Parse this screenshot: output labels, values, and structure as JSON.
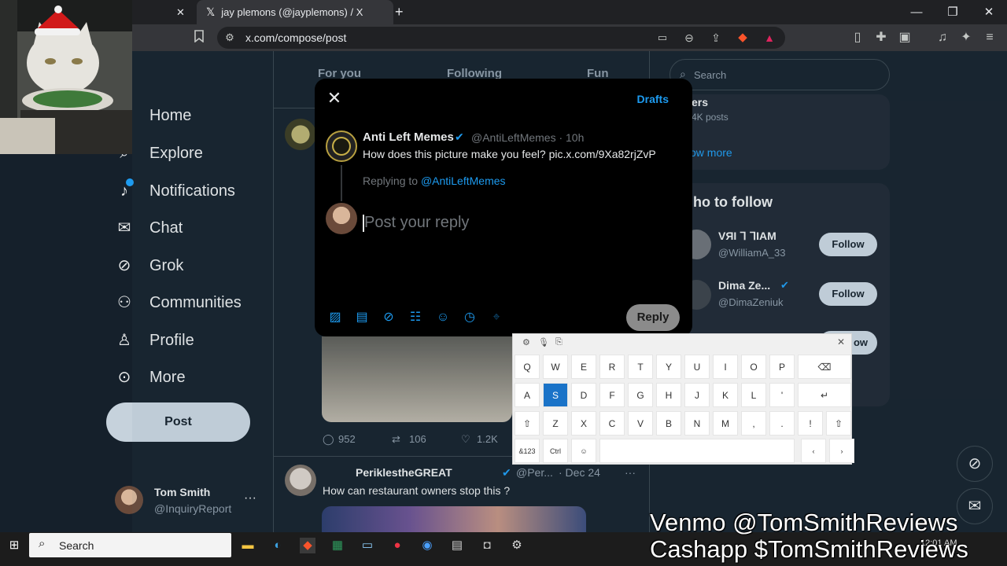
{
  "browser": {
    "tab_close_glyph": "✕",
    "tab_title": "jay plemons (@jayplemons) / X",
    "tab_logo": "𝕏",
    "new_tab_glyph": "+",
    "url": "x.com/compose/post"
  },
  "sidebar": {
    "items": [
      {
        "label": "Home",
        "icon": "home-icon"
      },
      {
        "label": "Explore",
        "icon": "search-icon"
      },
      {
        "label": "Notifications",
        "icon": "bell-icon"
      },
      {
        "label": "Chat",
        "icon": "mail-icon"
      },
      {
        "label": "Grok",
        "icon": "grok-icon"
      },
      {
        "label": "Communities",
        "icon": "communities-icon"
      },
      {
        "label": "Profile",
        "icon": "person-icon"
      },
      {
        "label": "More",
        "icon": "more-circle-icon"
      }
    ],
    "post_button": "Post",
    "account": {
      "name": "Tom Smith",
      "handle": "@InquiryReport",
      "more": "···"
    }
  },
  "feed": {
    "tabs": [
      "For you",
      "Following",
      "Fun"
    ],
    "tweet1_stats": {
      "replies": "952",
      "reposts": "106",
      "likes": "1.2K"
    },
    "tweet2": {
      "name": "PeriklestheGREAT",
      "handle": "@Per...",
      "date": "· Dec 24",
      "text": "How can restaurant owners stop this ?",
      "more": "···"
    }
  },
  "right": {
    "search_placeholder": "Search",
    "trend_partial": "ers",
    "trend_posts_partial": "4K posts",
    "show_more_partial": "ow more",
    "who_to_follow_partial": "ho to follow",
    "follow": [
      {
        "name": "VЯI ᒣ ᒣIAM",
        "handle": "@WilliamA_33",
        "button": "Follow"
      },
      {
        "name": "Dima Ze...",
        "handle": "@DimaZeniuk",
        "button": "Follow"
      }
    ],
    "third_follow_partial": "ow"
  },
  "modal": {
    "close": "✕",
    "drafts": "Drafts",
    "original": {
      "name": "Anti Left Memes",
      "handle": "@AntiLeftMemes · 10h",
      "text": "How does this picture make you feel? pic.x.com/9Xa82rjZvP"
    },
    "replying_prefix": "Replying to",
    "replying_handle": "@AntiLeftMemes",
    "reply_placeholder": "Post your reply",
    "reply_button": "Reply"
  },
  "keyboard": {
    "row1": [
      "Q",
      "W",
      "E",
      "R",
      "T",
      "Y",
      "U",
      "I",
      "O",
      "P",
      "⌫"
    ],
    "row2": [
      "A",
      "S",
      "D",
      "F",
      "G",
      "H",
      "J",
      "K",
      "L",
      "'",
      "↵"
    ],
    "row3": [
      "⇧",
      "Z",
      "X",
      "C",
      "V",
      "B",
      "N",
      "M",
      ",",
      ".",
      "!",
      "⇧"
    ],
    "row4": [
      "&123",
      "Ctrl",
      "☺",
      "",
      "‹",
      "›"
    ],
    "selected": "S",
    "close": "✕"
  },
  "taskbar": {
    "search": "Search",
    "clock": "12:01 AM"
  },
  "promo": {
    "line1": "Venmo @TomSmithReviews",
    "line2": "Cashapp $TomSmithReviews"
  },
  "colors": {
    "accent": "#1d9bf0",
    "background": "#15202b",
    "modal": "#000000",
    "keyboard_selected": "#1a73c8"
  }
}
